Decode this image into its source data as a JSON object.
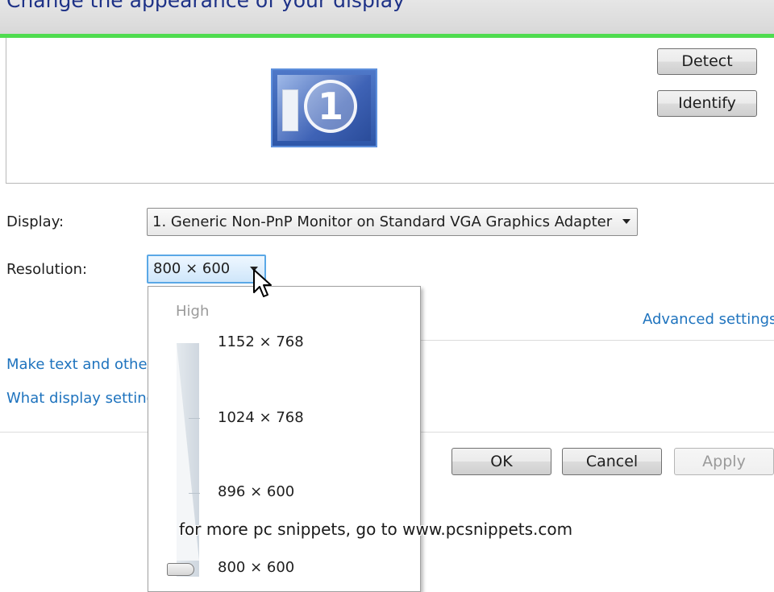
{
  "window": {
    "title": "Change the appearance of your display"
  },
  "preview": {
    "monitor_number": "1"
  },
  "buttons": {
    "detect": "Detect",
    "identify": "Identify",
    "ok": "OK",
    "cancel": "Cancel",
    "apply": "Apply"
  },
  "display": {
    "label": "Display:",
    "value": "1. Generic Non-PnP Monitor on Standard VGA Graphics Adapter"
  },
  "resolution": {
    "label": "Resolution:",
    "value": "800 × 600",
    "dropdown": {
      "high_label": "High",
      "options": [
        "1152 × 768",
        "1024 × 768",
        "896 × 600",
        "800 × 600"
      ],
      "selected": "800 × 600"
    }
  },
  "links": {
    "advanced": "Advanced settings",
    "make_text": "Make text and other",
    "what_display": "What display setting"
  },
  "overlay": {
    "watermark": "for more pc snippets, go to www.pcsnippets.com"
  },
  "colors": {
    "accent_green": "#4fdc4f",
    "link_blue": "#1e73be",
    "title_blue": "#1e3287"
  },
  "icons": [
    "monitor-icon",
    "chevron-down-icon",
    "mouse-cursor-icon"
  ]
}
